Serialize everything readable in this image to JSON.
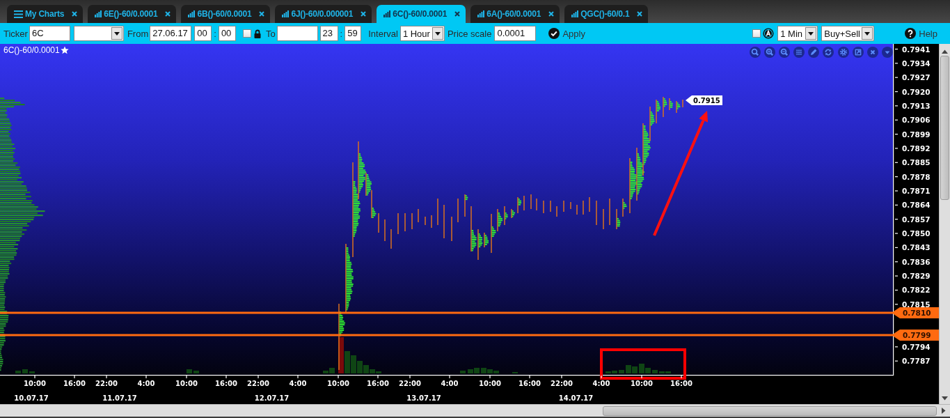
{
  "tabs": [
    {
      "label": "My Charts",
      "kind": "list",
      "selected": false
    },
    {
      "label": "6E()-60/0.0001",
      "kind": "chart",
      "selected": false
    },
    {
      "label": "6B()-60/0.0001",
      "kind": "chart",
      "selected": false
    },
    {
      "label": "6J()-60/0.000001",
      "kind": "chart",
      "selected": false
    },
    {
      "label": "6C()-60/0.0001",
      "kind": "chart",
      "selected": true
    },
    {
      "label": "6A()-60/0.0001",
      "kind": "chart",
      "selected": false
    },
    {
      "label": "QGC()-60/0.1",
      "kind": "chart",
      "selected": false
    }
  ],
  "toolbar": {
    "ticker": {
      "label": "Ticker",
      "value": "6C"
    },
    "from": {
      "label": "From",
      "date": "27.06.17",
      "hour": "00",
      "separator": ":",
      "minute": "00"
    },
    "lock": {
      "checked": false
    },
    "to": {
      "label": "To",
      "hour": "23",
      "separator": ":",
      "minute": "59"
    },
    "interval": {
      "label": "Interval",
      "value": "1 Hour"
    },
    "price_scale": {
      "label": "Price scale",
      "value": "0.0001"
    },
    "apply_button": "Apply",
    "auto_scale": {
      "checked": false
    },
    "timeframe": "1 Min",
    "side": "Buy+Sell",
    "help_button": "Help"
  },
  "chart": {
    "title": "6C()-60/0.0001",
    "last_price": "0.7915",
    "levels": [
      "0.7810",
      "0.7799"
    ],
    "price_axis": {
      "upper": [
        "0.7941",
        "0.7934",
        "0.7927",
        "0.7920",
        "0.7913",
        "0.7906",
        "0.7899",
        "0.7892",
        "0.7885",
        "0.7878",
        "0.7871",
        "0.7864",
        "0.7857",
        "0.7850",
        "0.7843",
        "0.7836",
        "0.7829",
        "0.7822",
        "0.7815"
      ],
      "lower": [
        "0.7794",
        "0.7787"
      ]
    },
    "time_labels": [
      "10:00",
      "16:00",
      "22:00",
      "4:00",
      "10:00",
      "16:00",
      "22:00",
      "4:00",
      "10:00",
      "16:00",
      "22:00",
      "4:00",
      "10:00",
      "16:00",
      "22:00",
      "4:00",
      "10:00",
      "16:00"
    ],
    "date_labels": [
      "10.07.17",
      "11.07.17",
      "12.07.17",
      "13.07.17",
      "14.07.17"
    ]
  }
}
